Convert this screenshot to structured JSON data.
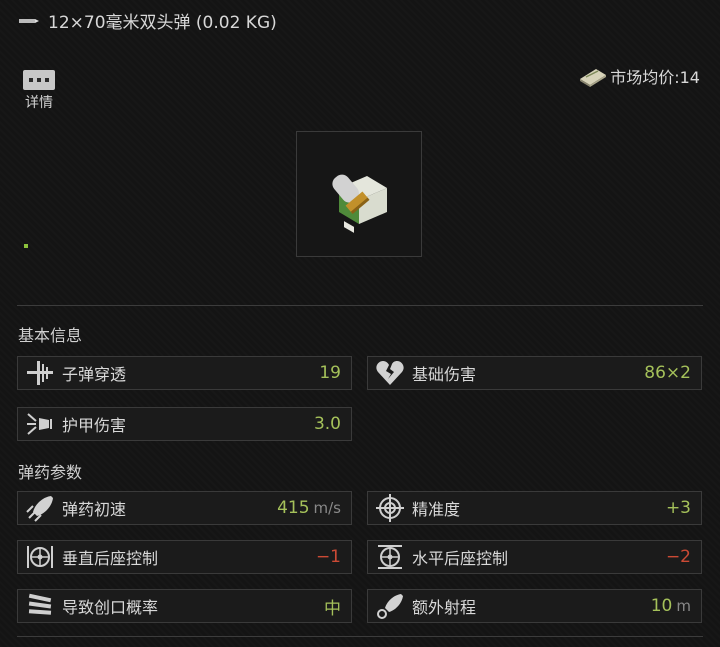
{
  "header": {
    "title": "12×70毫米双头弹 (0.02 KG)"
  },
  "details": {
    "label": "详情"
  },
  "market": {
    "label": "市场均价:14"
  },
  "sections": {
    "basic": "基本信息",
    "ammo": "弹药参数"
  },
  "basic_stats": [
    {
      "name": "子弹穿透",
      "value": "19",
      "icon": "penetration-icon"
    },
    {
      "name": "基础伤害",
      "value": "86×2",
      "icon": "broken-heart-icon"
    },
    {
      "name": "护甲伤害",
      "value": "3.0",
      "icon": "armor-damage-icon"
    }
  ],
  "ammo_stats": [
    {
      "name": "弹药初速",
      "value": "415",
      "unit": "m/s",
      "icon": "muzzle-velocity-icon"
    },
    {
      "name": "精准度",
      "value": "+3",
      "unit": "",
      "icon": "crosshair-icon"
    },
    {
      "name": "垂直后座控制",
      "value": "−1",
      "unit": "",
      "icon": "vertical-recoil-icon"
    },
    {
      "name": "水平后座控制",
      "value": "−2",
      "unit": "",
      "icon": "horizontal-recoil-icon"
    },
    {
      "name": "导致创口概率",
      "value": "中",
      "unit": "",
      "icon": "bleeding-icon"
    },
    {
      "name": "额外射程",
      "value": "10",
      "unit": "m",
      "icon": "range-icon"
    }
  ],
  "colors": {
    "positive": "#a5c15a",
    "negative": "#cb4a35",
    "accent": "#8cc23c"
  }
}
